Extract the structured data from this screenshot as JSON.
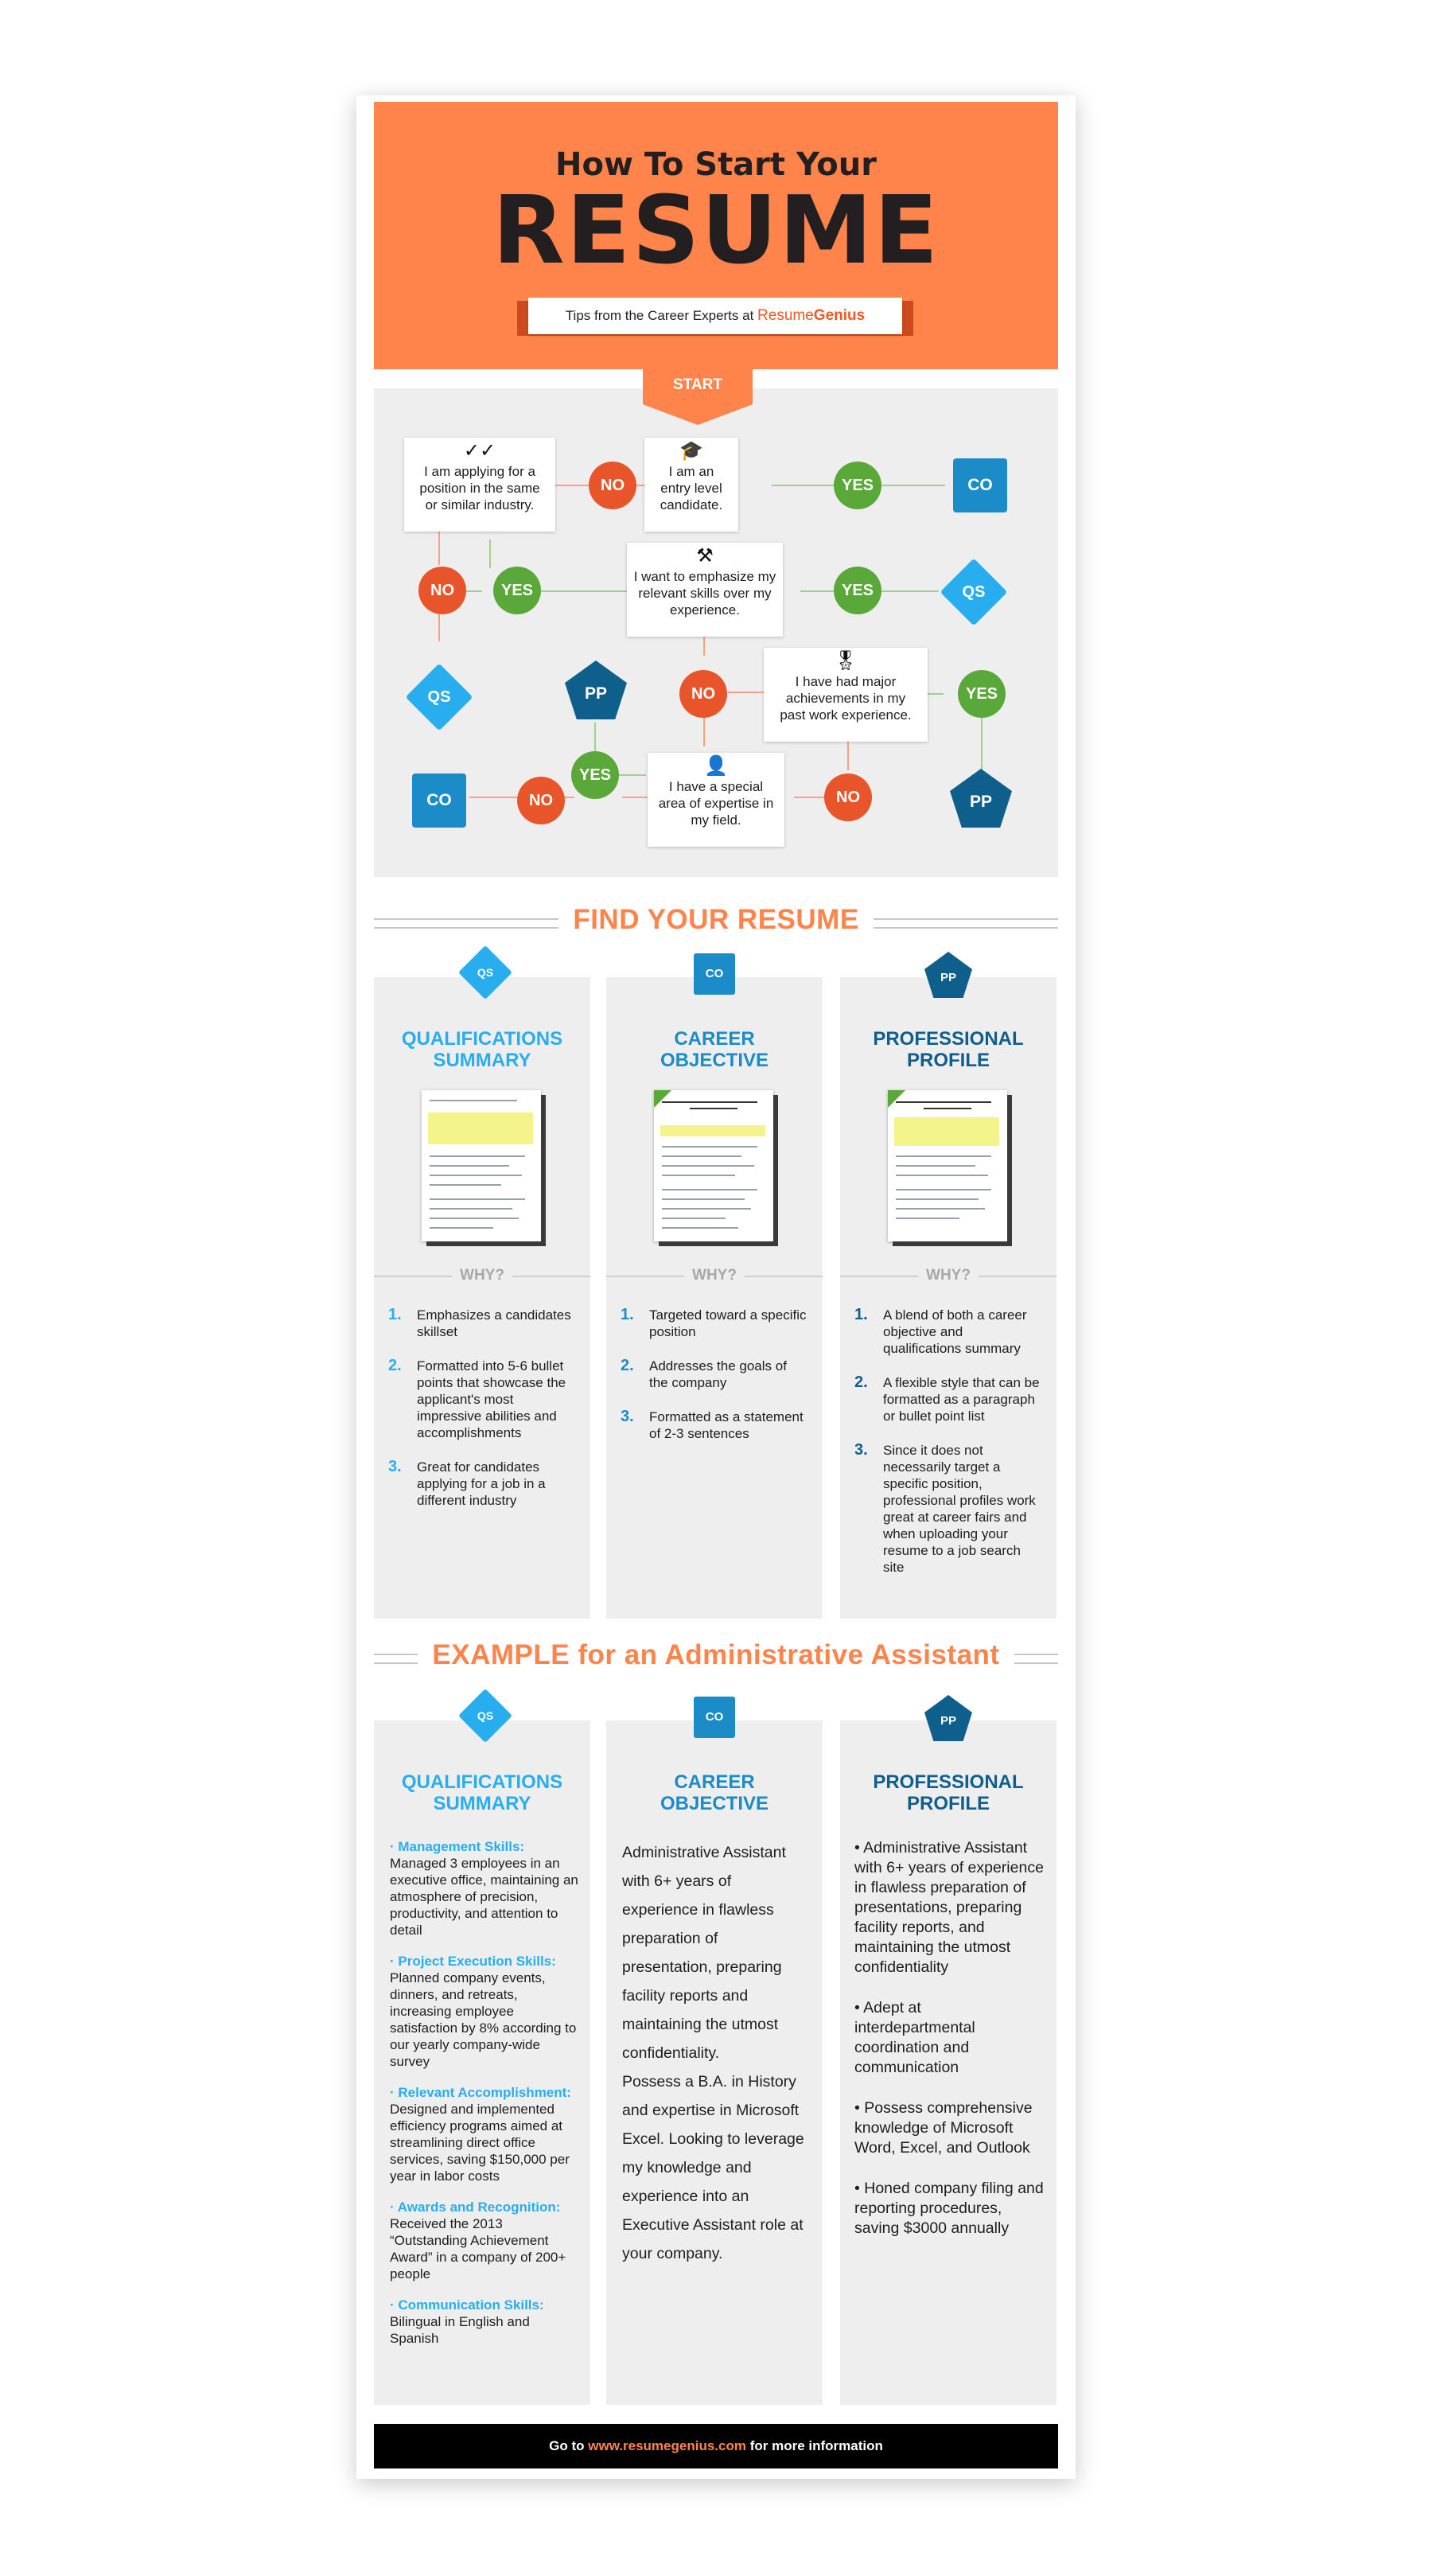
{
  "header": {
    "subtitle": "How To Start Your",
    "title": "RESUME",
    "ribbon_text": "Tips from the Career Experts at",
    "brand_part1": "Resume",
    "brand_part2": "Genius"
  },
  "flowchart": {
    "start": "START",
    "questions": {
      "same_industry": "I am applying for a position in the same or similar industry.",
      "entry_level": "I am an entry level candidate.",
      "emphasize_skills": "I want to emphasize my relevant skills over my experience.",
      "achievements": "I have had major achievements in my past work experience.",
      "expertise": "I have a special area of expertise in my field."
    },
    "yes": "YES",
    "no": "NO",
    "co": "CO",
    "qs": "QS",
    "pp": "PP"
  },
  "find_section": {
    "title": "FIND YOUR RESUME",
    "why": "WHY?",
    "panels": [
      {
        "badge": "QS",
        "title_line1": "QUALIFICATIONS",
        "title_line2": "SUMMARY",
        "points": [
          {
            "num": "1.",
            "text": "Emphasizes a candidates skillset"
          },
          {
            "num": "2.",
            "text": "Formatted into 5-6 bullet points that showcase the applicant's most impressive abilities and accomplishments"
          },
          {
            "num": "3.",
            "text": "Great for candidates applying for a job in a different industry"
          }
        ]
      },
      {
        "badge": "CO",
        "title_line1": "CAREER",
        "title_line2": "OBJECTIVE",
        "points": [
          {
            "num": "1.",
            "text": "Targeted toward a specific position"
          },
          {
            "num": "2.",
            "text": "Addresses the goals of the company"
          },
          {
            "num": "3.",
            "text": "Formatted as a statement of 2-3 sentences"
          }
        ]
      },
      {
        "badge": "PP",
        "title_line1": "PROFESSIONAL",
        "title_line2": "PROFILE",
        "points": [
          {
            "num": "1.",
            "text": "A blend of both a career objective and qualifications summary"
          },
          {
            "num": "2.",
            "text": "A flexible style that can be formatted as a paragraph or bullet point list"
          },
          {
            "num": "3.",
            "text": "Since it does not necessarily target a specific position, professional profiles work great at career fairs and when uploading your resume to a job search site"
          }
        ]
      }
    ]
  },
  "example_section": {
    "title": "EXAMPLE for an Administrative Assistant",
    "qs": {
      "badge": "QS",
      "title_line1": "QUALIFICATIONS",
      "title_line2": "SUMMARY",
      "items": [
        {
          "label": "· Management Skills:",
          "text": "Managed 3 employees in an executive office, maintaining an atmosphere of precision, productivity, and attention to detail"
        },
        {
          "label": "· Project Execution Skills:",
          "text": "Planned company events, dinners, and retreats, increasing employee satisfaction by 8% according to our yearly company-wide survey"
        },
        {
          "label": "· Relevant Accomplishment:",
          "text": "Designed and implemented efficiency programs aimed at streamlining direct office services, saving $150,000 per year in labor costs"
        },
        {
          "label": "· Awards and Recognition:",
          "text": "Received the 2013 “Outstanding Achievement Award” in a company of 200+ people"
        },
        {
          "label": "· Communication Skills:",
          "text": "Bilingual in English and Spanish"
        }
      ]
    },
    "co": {
      "badge": "CO",
      "title_line1": "CAREER",
      "title_line2": "OBJECTIVE",
      "paragraph1": "Administrative Assistant with 6+ years of experience in flawless preparation of presentation, preparing facility reports and maintaining the utmost confidentiality.",
      "paragraph2": "Possess a B.A. in History and expertise in Microsoft Excel. Looking to leverage my knowledge and experience into an Executive Assistant role at your company."
    },
    "pp": {
      "badge": "PP",
      "title_line1": "PROFESSIONAL",
      "title_line2": "PROFILE",
      "bullets": [
        "• Administrative Assistant with 6+ years of experience in flawless preparation of presentations, preparing facility reports, and maintaining the utmost confidentiality",
        "• Adept at interdepartmental coordination and communication",
        "• Possess comprehensive knowledge of Microsoft Word, Excel, and Outlook",
        "• Honed company filing and reporting procedures, saving $3000 annually"
      ]
    }
  },
  "footer": {
    "prefix": "Go to",
    "url": "www.resumegenius.com",
    "suffix": "for more information"
  },
  "colors": {
    "orange": "#ff844b",
    "yes_green": "#5aa83a",
    "no_red": "#e8552a",
    "qs_blue": "#28aeee",
    "co_blue": "#1b8cc7",
    "pp_navy": "#0e5f8c",
    "panel_gray": "#eeeeee"
  },
  "icons": {
    "same_industry": "double-check-icon",
    "entry_level": "graduation-cap-icon",
    "emphasize_skills": "tools-icon",
    "achievements": "award-ribbon-icon",
    "expertise": "person-icon"
  }
}
